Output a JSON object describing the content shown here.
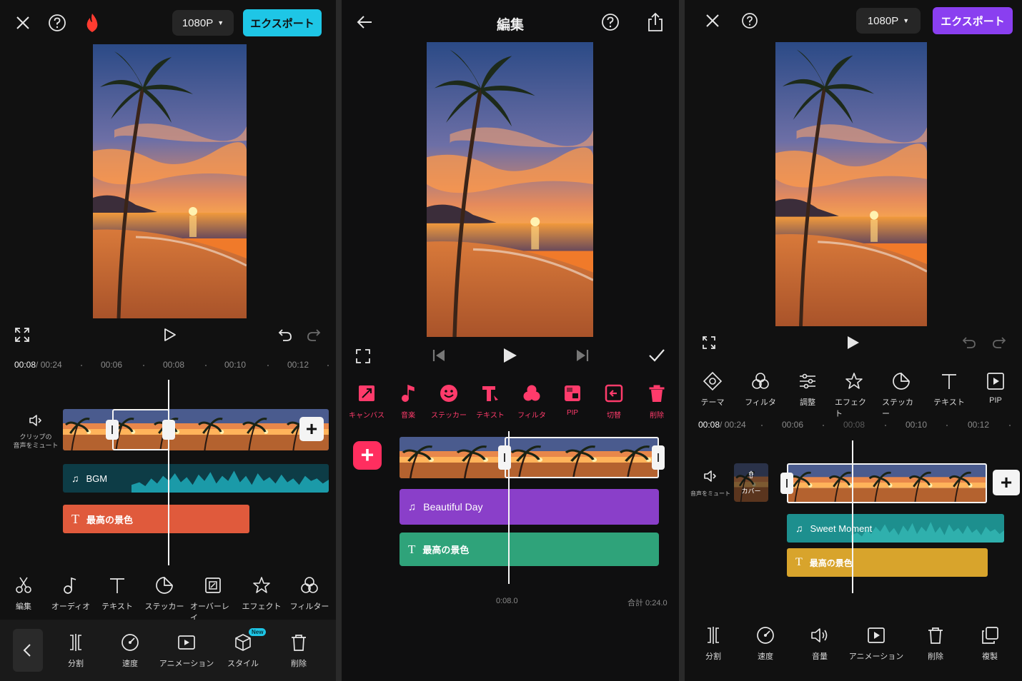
{
  "colors": {
    "cyan_export": "#1ec6e6",
    "purple_export": "#8a3ff0",
    "pink_accent": "#ff3b6b",
    "bgm_track": "#0d5a68",
    "text_track_orange": "#e05a3c",
    "purple_track": "#8a3fc9",
    "green_track": "#2fa37a",
    "teal_track": "#1d8f8e",
    "gold_track": "#d8a42c"
  },
  "panel1": {
    "resolution": "1080P",
    "export_label": "エクスポート",
    "time_current": "00:08",
    "time_total": " / 00:24",
    "ticks": [
      "00:06",
      "00:08",
      "00:10",
      "00:12"
    ],
    "mute_label_line1": "クリップの",
    "mute_label_line2": "音声をミュート",
    "bgm_label": "BGM",
    "text_track_label": "最高の景色",
    "tools": [
      {
        "icon": "scissors-icon",
        "label": "編集"
      },
      {
        "icon": "music-note-icon",
        "label": "オーディオ"
      },
      {
        "icon": "text-icon",
        "label": "テキスト"
      },
      {
        "icon": "sticker-icon",
        "label": "ステッカー"
      },
      {
        "icon": "overlay-icon",
        "label": "オーバーレイ"
      },
      {
        "icon": "effect-star-icon",
        "label": "エフェクト"
      },
      {
        "icon": "filter-icon",
        "label": "フィルター"
      }
    ],
    "bottom_tools": [
      {
        "icon": "split-icon",
        "label": "分割"
      },
      {
        "icon": "speed-icon",
        "label": "速度"
      },
      {
        "icon": "animation-icon",
        "label": "アニメーション"
      },
      {
        "icon": "style-cube-icon",
        "label": "スタイル",
        "badge": "New"
      },
      {
        "icon": "trash-icon",
        "label": "削除"
      }
    ]
  },
  "panel2": {
    "title": "編集",
    "tools": [
      {
        "icon": "canvas-icon",
        "label": "キャンバス"
      },
      {
        "icon": "music-icon",
        "label": "音楽"
      },
      {
        "icon": "sticker-smile-icon",
        "label": "ステッカー"
      },
      {
        "icon": "text-icon",
        "label": "テキスト"
      },
      {
        "icon": "filter-icon",
        "label": "フィルタ"
      },
      {
        "icon": "pip-icon",
        "label": "PIP"
      },
      {
        "icon": "transition-icon",
        "label": "切替"
      },
      {
        "icon": "trash-icon",
        "label": "削除"
      }
    ],
    "music_track_label": "Beautiful Day",
    "text_track_label": "最高の景色",
    "time_current": "0:08.0",
    "total_label": "合計 0:24.0"
  },
  "panel3": {
    "resolution": "1080P",
    "export_label": "エクスポート",
    "tools": [
      {
        "icon": "theme-icon",
        "label": "テーマ"
      },
      {
        "icon": "filter-icon",
        "label": "フィルタ"
      },
      {
        "icon": "adjust-icon",
        "label": "調整"
      },
      {
        "icon": "effect-star-icon",
        "label": "エフェクト"
      },
      {
        "icon": "sticker-icon",
        "label": "ステッカー"
      },
      {
        "icon": "text-icon",
        "label": "テキスト"
      },
      {
        "icon": "pip-play-icon",
        "label": "PIP"
      }
    ],
    "time_current": "00:08",
    "time_total": " / 00:24",
    "ticks": [
      "00:06",
      "00:08",
      "00:10",
      "00:12"
    ],
    "mute_label": "音声をミュート",
    "cover_label": "カバー",
    "music_track_label": "Sweet Moment",
    "text_track_label": "最高の景色",
    "bottom_tools": [
      {
        "icon": "split-icon",
        "label": "分割"
      },
      {
        "icon": "speed-icon",
        "label": "速度"
      },
      {
        "icon": "volume-icon",
        "label": "音量"
      },
      {
        "icon": "animation-icon",
        "label": "アニメーション"
      },
      {
        "icon": "trash-icon",
        "label": "削除"
      },
      {
        "icon": "duplicate-icon",
        "label": "複製"
      }
    ]
  }
}
